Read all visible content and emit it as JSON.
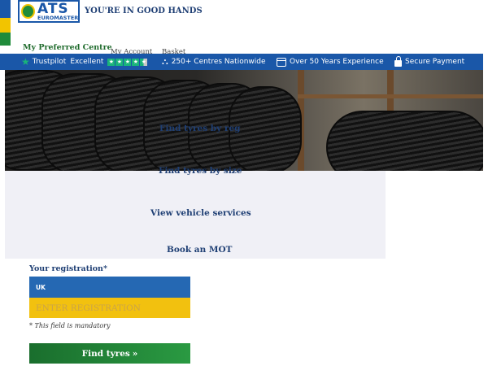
{
  "header": {
    "logo_text": "ATS",
    "logo_subtext": "EUROMASTER",
    "tagline": "YOU'RE IN GOOD HANDS",
    "preferred_centre": "My Preferred Centre",
    "account": "My Account",
    "basket": "Basket"
  },
  "trust_bar": {
    "trustpilot": "Trustpilot",
    "excellent": "Excellent",
    "stars": 4.5,
    "centres": "250+ Centres Nationwide",
    "experience": "Over 50 Years Experience",
    "payment": "Secure Payment"
  },
  "hero": {
    "find_by_reg": "Find tyres by reg"
  },
  "options": {
    "find_by_size": "Find tyres by size",
    "vehicle_services": "View vehicle services",
    "book_mot": "Book an MOT"
  },
  "form": {
    "reg_label": "Your registration*",
    "country": "UK",
    "reg_placeholder": "ENTER REGISTRATION",
    "mandatory_note": "* This field is mandatory",
    "find_button": "Find tyres",
    "find_button_arrow": "»"
  },
  "colors": {
    "brand_blue": "#1a57a8",
    "brand_green": "#1f8b3a",
    "brand_yellow": "#f2c400",
    "trustpilot_green": "#19b47a"
  }
}
